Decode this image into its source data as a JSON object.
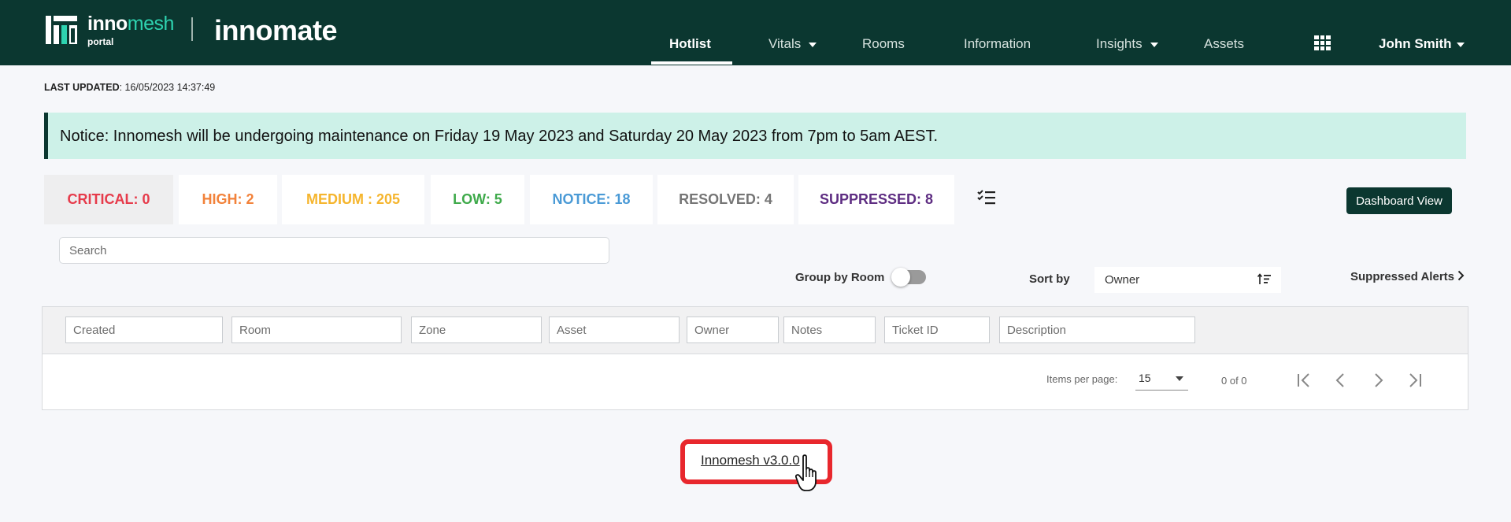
{
  "header": {
    "brand": {
      "part1": "inno",
      "part2": "mesh",
      "sub": "portal",
      "product": "innomate"
    },
    "nav": [
      {
        "label": "Hotlist",
        "active": true
      },
      {
        "label": "Vitals",
        "dropdown": true
      },
      {
        "label": "Rooms"
      },
      {
        "label": "Information"
      },
      {
        "label": "Insights",
        "dropdown": true
      },
      {
        "label": "Assets"
      }
    ],
    "apps_icon": "grid-icon",
    "user": "John Smith"
  },
  "last_updated": {
    "label": "LAST UPDATED",
    "value": ": 16/05/2023 14:37:49"
  },
  "notice": "Notice: Innomesh will be undergoing maintenance on Friday 19 May 2023 and Saturday 20 May 2023 from 7pm to 5am AEST.",
  "severity_tabs": [
    {
      "label": "CRITICAL: 0",
      "color": "#e63b4b"
    },
    {
      "label": "HIGH: 2",
      "color": "#f2823a"
    },
    {
      "label": "MEDIUM : 205",
      "color": "#f5b52e"
    },
    {
      "label": "LOW: 5",
      "color": "#3faa4b"
    },
    {
      "label": "NOTICE: 18",
      "color": "#4a9ad6"
    },
    {
      "label": "RESOLVED: 4",
      "color": "#757575"
    },
    {
      "label": "SUPPRESSED: 8",
      "color": "#5e2d82"
    }
  ],
  "dashboard_button": "Dashboard View",
  "search": {
    "placeholder": "Search"
  },
  "group_by_room": {
    "label": "Group by Room",
    "on": false
  },
  "sort": {
    "label": "Sort by",
    "value": "Owner"
  },
  "suppressed_link": "Suppressed Alerts",
  "filters": [
    {
      "placeholder": "Created"
    },
    {
      "placeholder": "Room"
    },
    {
      "placeholder": "Zone"
    },
    {
      "placeholder": "Asset"
    },
    {
      "placeholder": "Owner"
    },
    {
      "placeholder": "Notes"
    },
    {
      "placeholder": "Ticket ID"
    },
    {
      "placeholder": "Description"
    }
  ],
  "paginator": {
    "items_per_page_label": "Items per page:",
    "items_per_page": "15",
    "range": "0 of 0"
  },
  "version": "Innomesh v3.0.0",
  "colors": {
    "header_bg": "#0b3730",
    "accent": "#2ed3b0",
    "notice_bg": "#cdf1e8",
    "highlight": "#e8272d"
  }
}
